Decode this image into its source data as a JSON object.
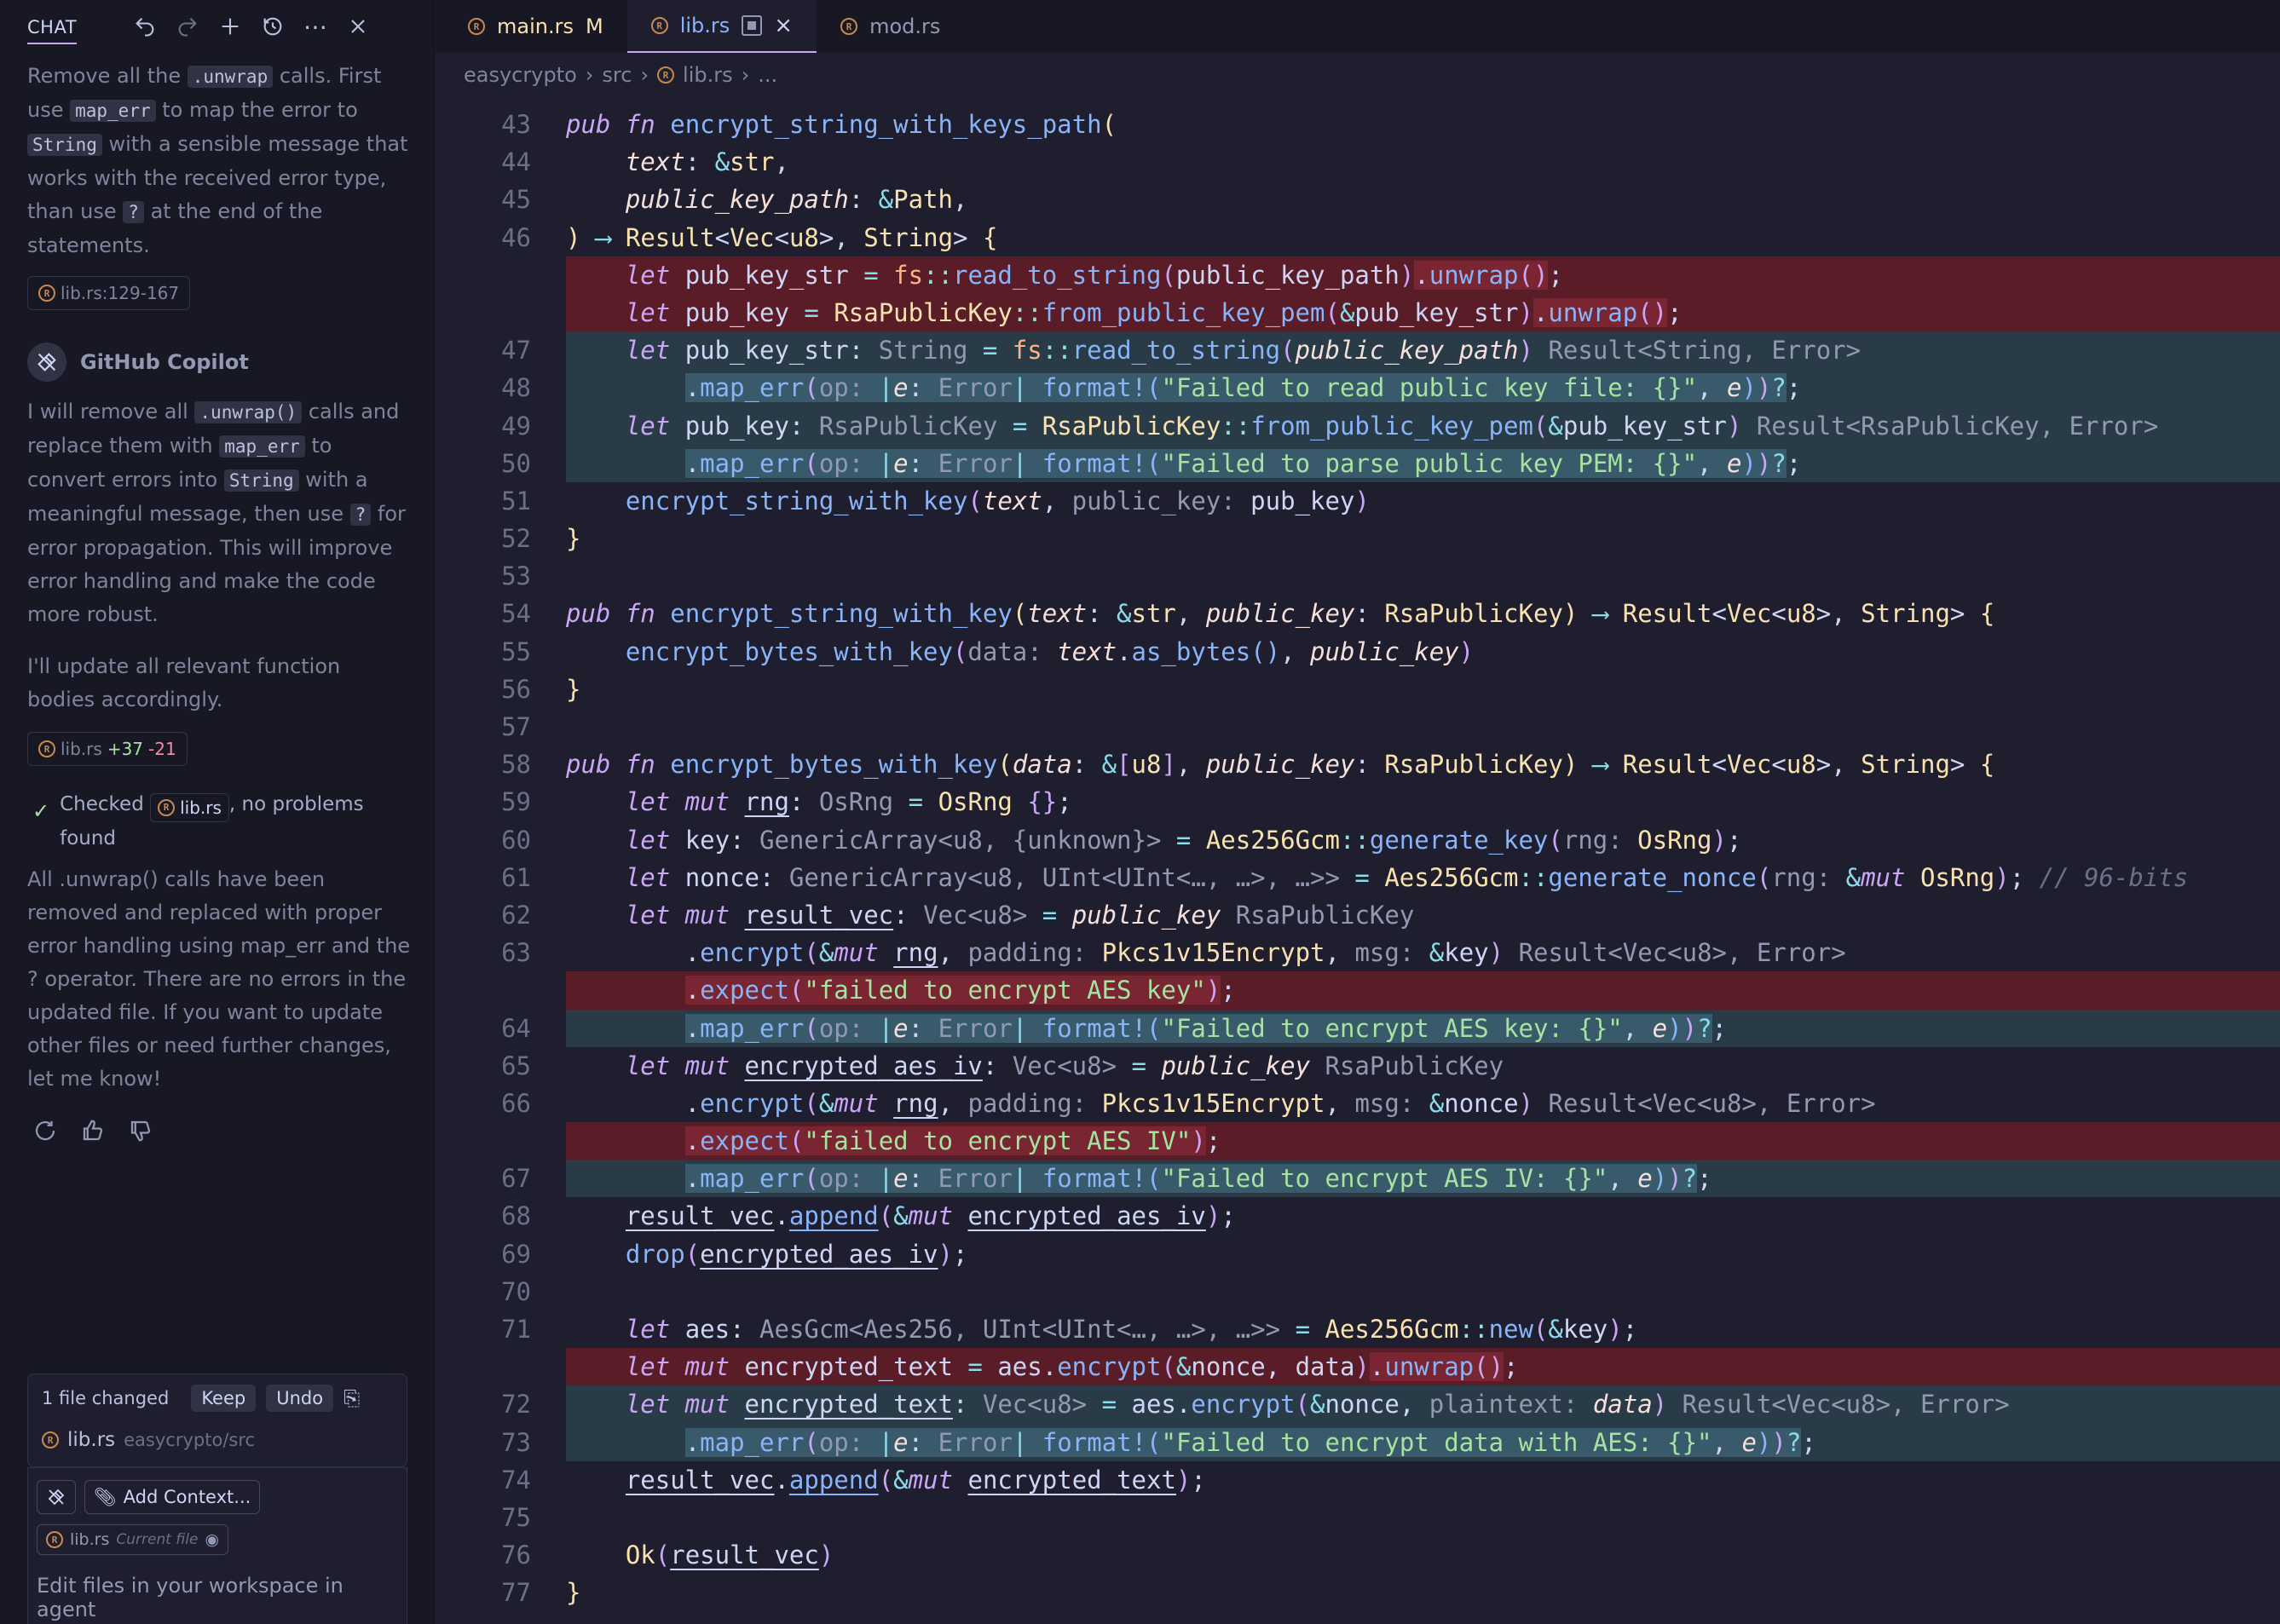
{
  "chat": {
    "title": "CHAT",
    "user_prompt": {
      "part1": "Remove all the ",
      "code1": ".unwrap",
      "part2": " calls. First use ",
      "code2": "map_err",
      "part3": " to map the error to ",
      "code3": "String",
      "part4": " with a sensible message that works with the received error type, than use ",
      "code4": "?",
      "part5": " at the end of the statements."
    },
    "reference_pill": "lib.rs:129-167",
    "assistant_name": "GitHub Copilot",
    "reply": {
      "part1": "I will remove all ",
      "code1": ".unwrap()",
      "part2": " calls and replace them with ",
      "code2": "map_err",
      "part3": " to convert errors into ",
      "code3": "String",
      "part4": " with a meaningful message, then use ",
      "code4": "?",
      "part5": " for error propagation. This will improve error handling and make the code more robust."
    },
    "reply2": "I'll update all relevant function bodies accordingly.",
    "edit_pill": {
      "file": "lib.rs",
      "adds": "+37",
      "dels": "-21"
    },
    "checked": {
      "prefix": "Checked",
      "file": "lib.rs",
      "suffix": ", no problems found"
    },
    "summary": "All .unwrap() calls have been removed and replaced with proper error handling using map_err and the ? operator. There are no errors in the updated file. If you want to update other files or need further changes, let me know!",
    "changed": {
      "label": "1 file changed",
      "keep": "Keep",
      "undo": "Undo",
      "file": "lib.rs",
      "path": "easycrypto/src"
    },
    "input": {
      "add_context": "Add Context...",
      "ctx_file": "lib.rs",
      "ctx_sub": "Current file",
      "placeholder": "Edit files in your workspace in agent"
    }
  },
  "tabs": [
    {
      "name": "main.rs",
      "badge": "M"
    },
    {
      "name": "lib.rs",
      "badge": ""
    },
    {
      "name": "mod.rs",
      "badge": ""
    }
  ],
  "breadcrumb": {
    "p1": "easycrypto",
    "p2": "src",
    "p3": "lib.rs",
    "p4": "..."
  },
  "code_lines": [
    {
      "n": "43",
      "kind": "",
      "html": "<span class='kw'>pub fn</span> <span class='fn'>encrypt_string_with_keys_path</span><span class='br'>(</span>"
    },
    {
      "n": "44",
      "kind": "",
      "html": "    <span class='pa'>text</span>: <span class='op'>&amp;</span><span class='ty'>str</span>,"
    },
    {
      "n": "45",
      "kind": "",
      "html": "    <span class='pa'>public_key_path</span>: <span class='op'>&amp;</span><span class='ty'>Path</span>,"
    },
    {
      "n": "46",
      "kind": "",
      "html": "<span class='br'>)</span> <span class='op'>⟶</span> <span class='ty'>Result</span>&lt;<span class='ty'>Vec</span>&lt;<span class='ty'>u8</span>&gt;, <span class='ty'>String</span>&gt; <span class='br'>{</span>"
    },
    {
      "n": "",
      "kind": "del",
      "html": "    <span class='kw'>let</span> pub_key_str <span class='op'>=</span> <span class='mod-ns'>fs</span><span class='nsop'>::</span><span class='fn'>read_to_string</span><span class='br2'>(</span>public_key_path<span class='br2'>)</span><span class='del-hl'>.<span class='fn'>unwrap</span><span class='br2'>()</span></span>;"
    },
    {
      "n": "",
      "kind": "del",
      "html": "    <span class='kw'>let</span> pub_key <span class='op'>=</span> <span class='ty'>RsaPublicKey</span><span class='nsop'>::</span><span class='fn'>from_public_key_pem</span><span class='br2'>(</span><span class='op'>&amp;</span>pub_key_str<span class='br2'>)</span><span class='del-hl'>.<span class='fn'>unwrap</span><span class='br2'>()</span></span>;"
    },
    {
      "n": "47",
      "kind": "add",
      "html": "    <span class='kw'>let</span> pub_key_str: <span class='tyg'>String</span> <span class='op'>=</span> <span class='mod-ns'>fs</span><span class='nsop'>::</span><span class='fn'>read_to_string</span><span class='br2'>(</span><span class='pa'>public_key_path</span><span class='br2'>)</span> <span class='hint'>Result&lt;String, Error&gt;</span>"
    },
    {
      "n": "48",
      "kind": "add",
      "html": "        <span class='add-hl'>.<span class='fn'>map_err</span><span class='br2'>(</span><span class='hint'>op:</span> <span class='op'>|</span><span class='pa'>e</span>: <span class='hint'>Error</span><span class='op'>|</span> <span class='mac'>format!</span><span class='br3'>(</span><span class='st'>\"Failed to read public key file: {}\"</span>, <span class='pa'>e</span><span class='br3'>)</span><span class='br2'>)</span><span class='op'>?</span></span>;"
    },
    {
      "n": "49",
      "kind": "add",
      "html": "    <span class='kw'>let</span> pub_key: <span class='tyg'>RsaPublicKey</span> <span class='op'>=</span> <span class='ty'>RsaPublicKey</span><span class='nsop'>::</span><span class='fn'>from_public_key_pem</span><span class='br2'>(</span><span class='op'>&amp;</span>pub_key_str<span class='br2'>)</span> <span class='hint'>Result&lt;RsaPublicKey, Error&gt;</span>"
    },
    {
      "n": "50",
      "kind": "add",
      "html": "        <span class='add-hl'>.<span class='fn'>map_err</span><span class='br2'>(</span><span class='hint'>op:</span> <span class='op'>|</span><span class='pa'>e</span>: <span class='hint'>Error</span><span class='op'>|</span> <span class='mac'>format!</span><span class='br3'>(</span><span class='st'>\"Failed to parse public key PEM: {}\"</span>, <span class='pa'>e</span><span class='br3'>)</span><span class='br2'>)</span><span class='op'>?</span></span>;"
    },
    {
      "n": "51",
      "kind": "",
      "html": "    <span class='fn'>encrypt_string_with_key</span><span class='br2'>(</span><span class='pa'>text</span>, <span class='hint'>public_key:</span> pub_key<span class='br2'>)</span>"
    },
    {
      "n": "52",
      "kind": "",
      "html": "<span class='br'>}</span>"
    },
    {
      "n": "53",
      "kind": "",
      "html": ""
    },
    {
      "n": "54",
      "kind": "",
      "html": "<span class='kw'>pub fn</span> <span class='fn'>encrypt_string_with_key</span><span class='br'>(</span><span class='pa'>text</span>: <span class='op'>&amp;</span><span class='ty'>str</span>, <span class='pa'>public_key</span>: <span class='ty'>RsaPublicKey</span><span class='br'>)</span> <span class='op'>⟶</span> <span class='ty'>Result</span>&lt;<span class='ty'>Vec</span>&lt;<span class='ty'>u8</span>&gt;, <span class='ty'>String</span>&gt; <span class='br'>{</span>"
    },
    {
      "n": "55",
      "kind": "",
      "html": "    <span class='fn'>encrypt_bytes_with_key</span><span class='br2'>(</span><span class='hint'>data:</span> <span class='pa'>text</span>.<span class='fn'>as_bytes</span><span class='br3'>()</span>, <span class='pa'>public_key</span><span class='br2'>)</span>"
    },
    {
      "n": "56",
      "kind": "",
      "html": "<span class='br'>}</span>"
    },
    {
      "n": "57",
      "kind": "",
      "html": ""
    },
    {
      "n": "58",
      "kind": "",
      "html": "<span class='kw'>pub fn</span> <span class='fn'>encrypt_bytes_with_key</span><span class='br'>(</span><span class='pa'>data</span>: <span class='op'>&amp;</span><span class='br2'>[</span><span class='ty'>u8</span><span class='br2'>]</span>, <span class='pa'>public_key</span>: <span class='ty'>RsaPublicKey</span><span class='br'>)</span> <span class='op'>⟶</span> <span class='ty'>Result</span>&lt;<span class='ty'>Vec</span>&lt;<span class='ty'>u8</span>&gt;, <span class='ty'>String</span>&gt; <span class='br'>{</span>"
    },
    {
      "n": "59",
      "kind": "",
      "html": "    <span class='kw'>let mut</span> <span class='ul'>rng</span>: <span class='tyg'>OsRng</span> <span class='op'>=</span> <span class='ty'>OsRng</span> <span class='br2'>{}</span>;"
    },
    {
      "n": "60",
      "kind": "",
      "html": "    <span class='kw'>let</span> key: <span class='tyg'>GenericArray&lt;u8, {unknown}&gt;</span> <span class='op'>=</span> <span class='ty'>Aes256Gcm</span><span class='nsop'>::</span><span class='fn'>generate_key</span><span class='br2'>(</span><span class='hint'>rng:</span> <span class='ty'>OsRng</span><span class='br2'>)</span>;"
    },
    {
      "n": "61",
      "kind": "",
      "html": "    <span class='kw'>let</span> nonce: <span class='tyg'>GenericArray&lt;u8, UInt&lt;UInt&lt;…, …&gt;, …&gt;&gt;</span> <span class='op'>=</span> <span class='ty'>Aes256Gcm</span><span class='nsop'>::</span><span class='fn'>generate_nonce</span><span class='br2'>(</span><span class='hint'>rng:</span> <span class='op'>&amp;</span><span class='kw'>mut</span> <span class='ty'>OsRng</span><span class='br2'>)</span>; <span class='cm'>// 96-bits</span>"
    },
    {
      "n": "62",
      "kind": "",
      "html": "    <span class='kw'>let mut</span> <span class='ul'>result_vec</span>: <span class='tyg'>Vec&lt;u8&gt;</span> <span class='op'>=</span> <span class='pa'>public_key</span> <span class='hint'>RsaPublicKey</span>"
    },
    {
      "n": "63",
      "kind": "",
      "html": "        .<span class='fn'>encrypt</span><span class='br2'>(</span><span class='op'>&amp;</span><span class='kw'>mut</span> <span class='ul'>rng</span>, <span class='hint'>padding:</span> <span class='ty'>Pkcs1v15Encrypt</span>, <span class='hint'>msg:</span> <span class='op'>&amp;</span>key<span class='br2'>)</span> <span class='hint'>Result&lt;Vec&lt;u8&gt;, Error&gt;</span>"
    },
    {
      "n": "",
      "kind": "del",
      "html": "        <span class='del-hl'>.<span class='fn'>expect</span><span class='br2'>(</span><span class='st'>\"failed to encrypt AES key\"</span><span class='br2'>)</span></span>;"
    },
    {
      "n": "64",
      "kind": "add",
      "html": "        <span class='add-hl'>.<span class='fn'>map_err</span><span class='br2'>(</span><span class='hint'>op:</span> <span class='op'>|</span><span class='pa'>e</span>: <span class='hint'>Error</span><span class='op'>|</span> <span class='mac'>format!</span><span class='br3'>(</span><span class='st'>\"Failed to encrypt AES key: {}\"</span>, <span class='pa'>e</span><span class='br3'>)</span><span class='br2'>)</span><span class='op'>?</span></span>;"
    },
    {
      "n": "65",
      "kind": "",
      "html": "    <span class='kw'>let mut</span> <span class='ul'>encrypted_aes_iv</span>: <span class='tyg'>Vec&lt;u8&gt;</span> <span class='op'>=</span> <span class='pa'>public_key</span> <span class='hint'>RsaPublicKey</span>"
    },
    {
      "n": "66",
      "kind": "",
      "html": "        .<span class='fn'>encrypt</span><span class='br2'>(</span><span class='op'>&amp;</span><span class='kw'>mut</span> <span class='ul'>rng</span>, <span class='hint'>padding:</span> <span class='ty'>Pkcs1v15Encrypt</span>, <span class='hint'>msg:</span> <span class='op'>&amp;</span>nonce<span class='br2'>)</span> <span class='hint'>Result&lt;Vec&lt;u8&gt;, Error&gt;</span>"
    },
    {
      "n": "",
      "kind": "del",
      "html": "        <span class='del-hl'>.<span class='fn'>expect</span><span class='br2'>(</span><span class='st'>\"failed to encrypt AES IV\"</span><span class='br2'>)</span></span>;"
    },
    {
      "n": "67",
      "kind": "add",
      "html": "        <span class='add-hl'>.<span class='fn'>map_err</span><span class='br2'>(</span><span class='hint'>op:</span> <span class='op'>|</span><span class='pa'>e</span>: <span class='hint'>Error</span><span class='op'>|</span> <span class='mac'>format!</span><span class='br3'>(</span><span class='st'>\"Failed to encrypt AES IV: {}\"</span>, <span class='pa'>e</span><span class='br3'>)</span><span class='br2'>)</span><span class='op'>?</span></span>;"
    },
    {
      "n": "68",
      "kind": "",
      "html": "    <span class='ul'>result_vec</span>.<span class='fn ul'>append</span><span class='br2'>(</span><span class='op'>&amp;</span><span class='kw'>mut</span> <span class='ul'>encrypted_aes_iv</span><span class='br2'>)</span>;"
    },
    {
      "n": "69",
      "kind": "",
      "html": "    <span class='fn'>drop</span><span class='br2'>(</span><span class='ul'>encrypted_aes_iv</span><span class='br2'>)</span>;"
    },
    {
      "n": "70",
      "kind": "",
      "html": ""
    },
    {
      "n": "71",
      "kind": "",
      "html": "    <span class='kw'>let</span> aes: <span class='tyg'>AesGcm&lt;Aes256, UInt&lt;UInt&lt;…, …&gt;, …&gt;&gt;</span> <span class='op'>=</span> <span class='ty'>Aes256Gcm</span><span class='nsop'>::</span><span class='fn'>new</span><span class='br2'>(</span><span class='op'>&amp;</span>key<span class='br2'>)</span>;"
    },
    {
      "n": "",
      "kind": "del",
      "html": "    <span class='kw'>let mut</span> encrypted_text <span class='op'>=</span> aes.<span class='fn'>encrypt</span><span class='br2'>(</span><span class='op'>&amp;</span>nonce, data<span class='br2'>)</span><span class='del-hl'>.<span class='fn'>unwrap</span><span class='br2'>()</span></span>;"
    },
    {
      "n": "72",
      "kind": "add",
      "html": "    <span class='kw'>let mut</span> <span class='ul'>encrypted_text</span>: <span class='tyg'>Vec&lt;u8&gt;</span> <span class='op'>=</span> aes.<span class='fn'>encrypt</span><span class='br2'>(</span><span class='op'>&amp;</span>nonce, <span class='hint'>plaintext:</span> <span class='pa'>data</span><span class='br2'>)</span> <span class='hint'>Result&lt;Vec&lt;u8&gt;, Error&gt;</span>"
    },
    {
      "n": "73",
      "kind": "add",
      "html": "        <span class='add-hl'>.<span class='fn'>map_err</span><span class='br2'>(</span><span class='hint'>op:</span> <span class='op'>|</span><span class='pa'>e</span>: <span class='hint'>Error</span><span class='op'>|</span> <span class='mac'>format!</span><span class='br3'>(</span><span class='st'>\"Failed to encrypt data with AES: {}\"</span>, <span class='pa'>e</span><span class='br3'>)</span><span class='br2'>)</span><span class='op'>?</span></span>;"
    },
    {
      "n": "74",
      "kind": "",
      "html": "    <span class='ul'>result_vec</span>.<span class='fn ul'>append</span><span class='br2'>(</span><span class='op'>&amp;</span><span class='kw'>mut</span> <span class='ul'>encrypted_text</span><span class='br2'>)</span>;"
    },
    {
      "n": "75",
      "kind": "",
      "html": ""
    },
    {
      "n": "76",
      "kind": "",
      "html": "    <span class='ty'>Ok</span><span class='br2'>(</span><span class='ul'>result_vec</span><span class='br2'>)</span>"
    },
    {
      "n": "77",
      "kind": "",
      "html": "<span class='br'>}</span>"
    }
  ]
}
